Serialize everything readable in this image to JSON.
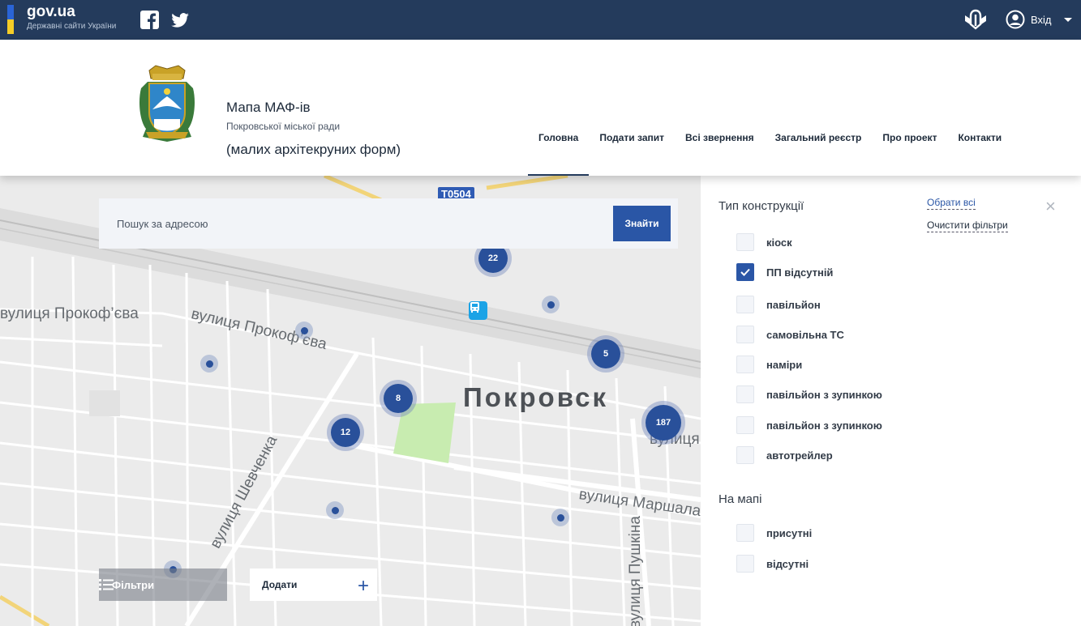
{
  "govbar": {
    "title": "gov.ua",
    "subtitle": "Державні сайти України",
    "login_label": "Вхід",
    "flag_colors": [
      "#2a64d6",
      "#f5cd27"
    ]
  },
  "header": {
    "title_line1": "Мапа МАФ-ів",
    "title_line2": "(малих архітекруних форм)",
    "subtitle": "Покровської міської ради",
    "nav": [
      "Головна",
      "Подати запит",
      "Всі звернення",
      "Загальний реєстр",
      "Про проект",
      "Контакти"
    ],
    "active_nav": "Головна"
  },
  "map": {
    "search_placeholder": "Пошук за адресою",
    "search_button": "Знайти",
    "road_badge": "T0504",
    "city_label": "Покровск",
    "streets": [
      "вулиця Прокоф’єва",
      "вулиця Прокоф’єва",
      "вулиця Шевченка",
      "вулиця Маршала",
      "вулиця Пушкіна",
      "вулиця"
    ],
    "clusters": [
      "22",
      "5",
      "8",
      "12",
      "187"
    ],
    "filters_button": "Фільтри",
    "add_button": "Додати"
  },
  "filters": {
    "section1_title": "Тип конструкції",
    "select_all": "Обрати всі",
    "clear_filters": "Очистити фільтри",
    "types": [
      {
        "label": "кіоск",
        "checked": false
      },
      {
        "label": "ПП відсутній",
        "checked": true
      },
      {
        "label": "павільйон",
        "checked": false
      },
      {
        "label": "самовільна ТС",
        "checked": false
      },
      {
        "label": "наміри",
        "checked": false
      },
      {
        "label": "павільйон з зупинкою",
        "checked": false
      },
      {
        "label": "павільйон з зупинкою",
        "checked": false
      },
      {
        "label": "автотрейлер",
        "checked": false
      }
    ],
    "section2_title": "На мапі",
    "map_presence": [
      {
        "label": "присутні",
        "checked": false
      },
      {
        "label": "відсутні",
        "checked": false
      }
    ]
  },
  "colors": {
    "gov_bar": "#243b5c",
    "accent": "#2a56a6",
    "cluster": "#29509a",
    "park": "#c8ecb0"
  }
}
